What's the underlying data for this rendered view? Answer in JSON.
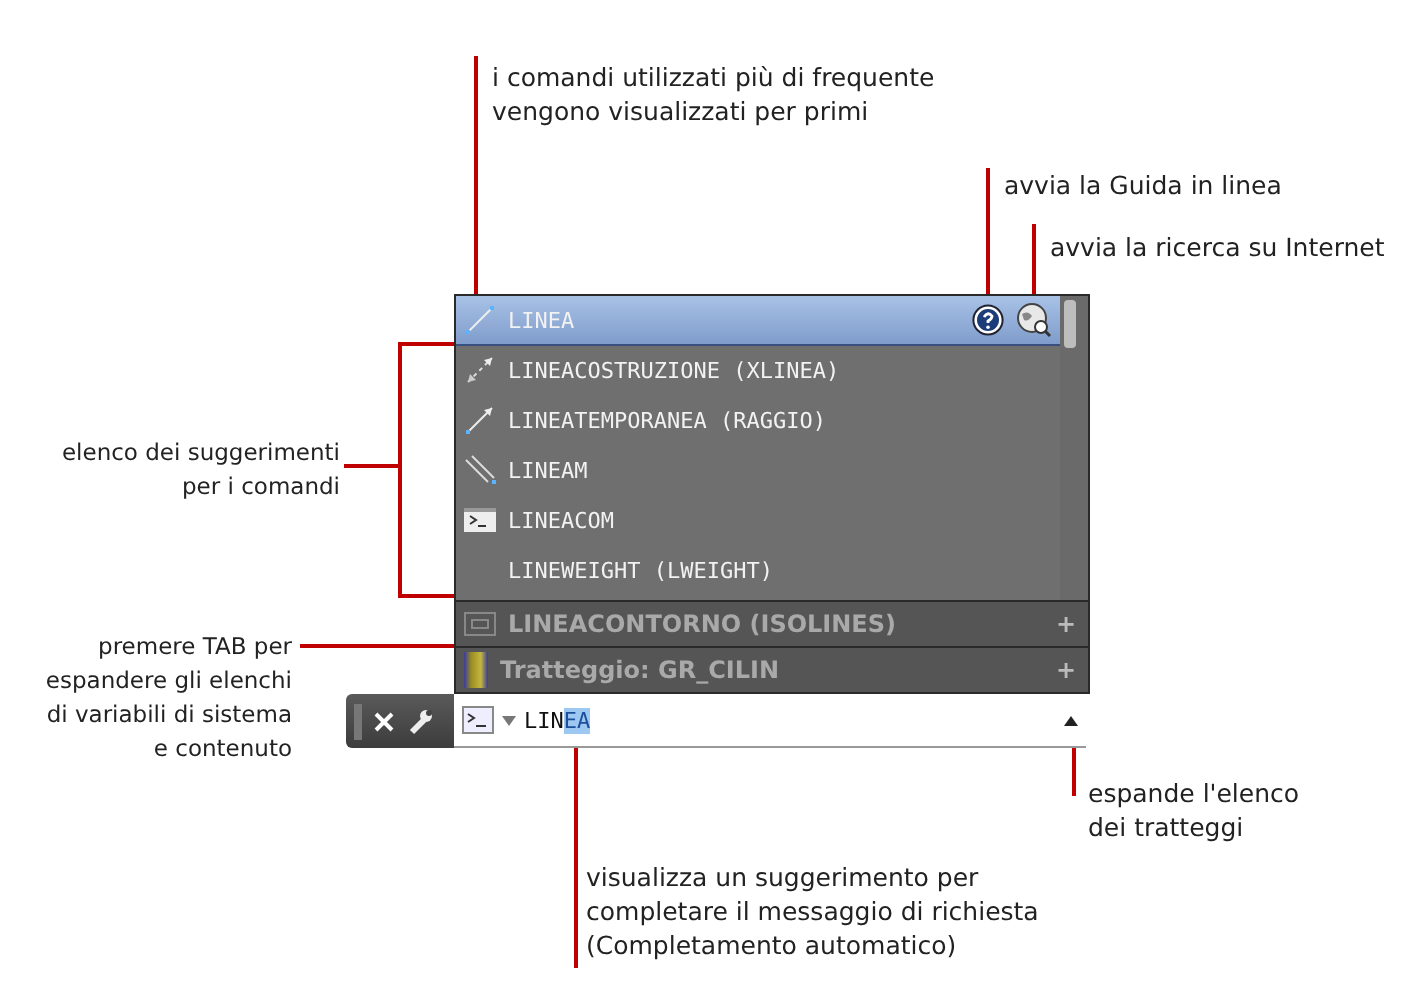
{
  "suggestions": [
    {
      "label": "LINEA",
      "kind": "line",
      "selected": true
    },
    {
      "label": "LINEACOSTRUZIONE (XLINEA)",
      "kind": "xline",
      "selected": false
    },
    {
      "label": "LINEATEMPORANEA (RAGGIO)",
      "kind": "ray",
      "selected": false
    },
    {
      "label": "LINEAM",
      "kind": "mline",
      "selected": false
    },
    {
      "label": "LINEACOM",
      "kind": "command",
      "selected": false
    },
    {
      "label": "LINEWEIGHT (LWEIGHT)",
      "kind": "none",
      "selected": false
    }
  ],
  "sections": [
    {
      "label": "LINEACONTORNO (ISOLINES)",
      "kind": "sysvar",
      "expand": "+"
    },
    {
      "label": "Tratteggio: GR_CILIN",
      "kind": "hatch",
      "expand": "+"
    }
  ],
  "command_line": {
    "typed": "LIN",
    "autocomplete": "EA"
  },
  "annotations": [
    {
      "text": "i comandi utilizzati più di frequente\nvengono visualizzati per primi"
    },
    {
      "text": "avvia la Guida in linea"
    },
    {
      "text": "avvia la ricerca su Internet"
    },
    {
      "text": "elenco dei suggerimenti\nper i comandi"
    },
    {
      "text": "premere TAB per\nespandere gli elenchi\ndi variabili di sistema\ne contenuto"
    },
    {
      "text": "espande l'elenco\ndei tratteggi"
    },
    {
      "text": "visualizza un suggerimento per\ncompletare il messaggio di richiesta\n(Completamento automatico)"
    }
  ]
}
